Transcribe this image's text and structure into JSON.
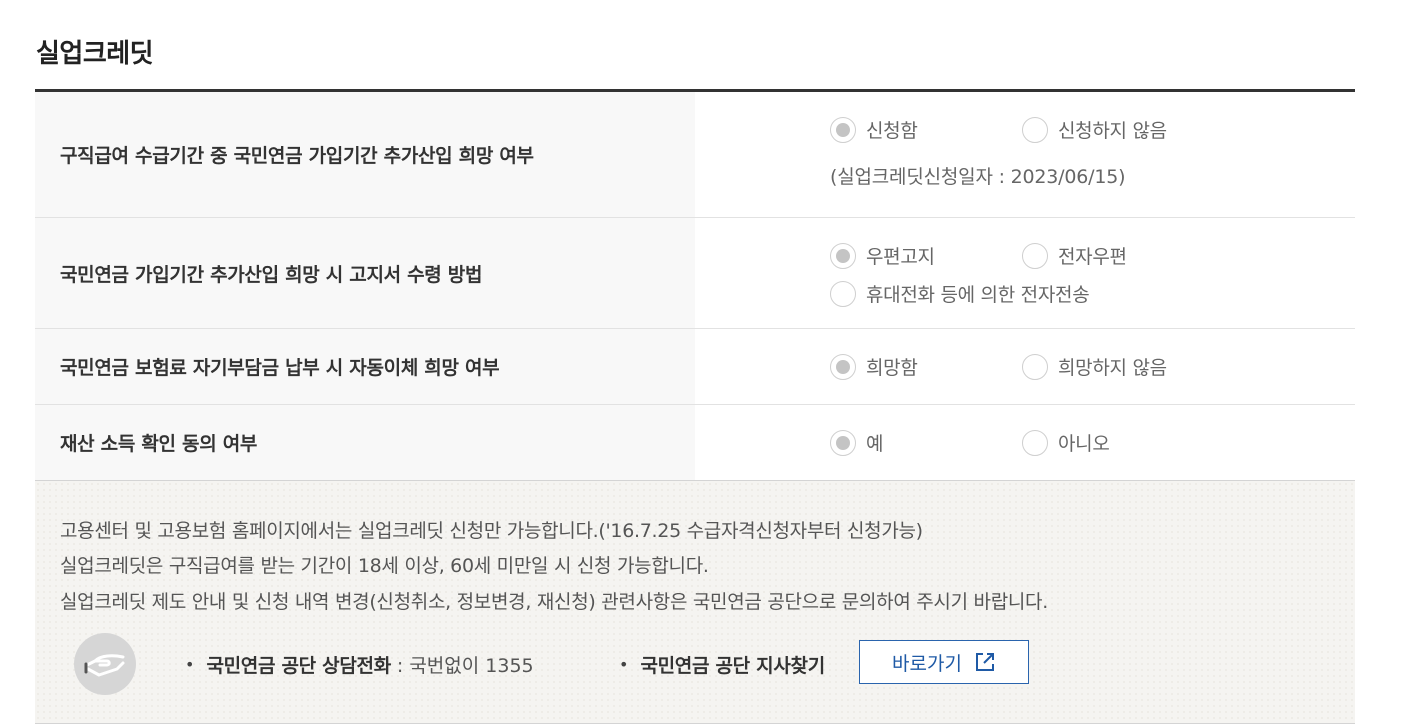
{
  "page_title": "실업크레딧",
  "rows": [
    {
      "label": "구직급여 수급기간 중 국민연금 가입기간 추가산입 희망 여부",
      "options": [
        "신청함",
        "신청하지 않음"
      ],
      "selected": 0,
      "note": "(실업크레딧신청일자 : 2023/06/15)"
    },
    {
      "label": "국민연금 가입기간 추가산입 희망 시 고지서 수령 방법",
      "options": [
        "우편고지",
        "전자우편",
        "휴대전화 등에 의한 전자전송"
      ],
      "selected": 0
    },
    {
      "label": "국민연금 보험료 자기부담금 납부 시 자동이체 희망 여부",
      "options": [
        "희망함",
        "희망하지 않음"
      ],
      "selected": 0
    },
    {
      "label": "재산 소득 확인 동의 여부",
      "options": [
        "예",
        "아니오"
      ],
      "selected": 0
    }
  ],
  "info": {
    "lines": [
      "고용센터 및 고용보험 홈페이지에서는 실업크레딧 신청만 가능합니다.('16.7.25 수급자격신청자부터 신청가능)",
      "실업크레딧은 구직급여를 받는 기간이 18세 이상, 60세 미만일 시 신청 가능합니다.",
      "실업크레딧 제도 안내 및 신청 내역 변경(신청취소, 정보변경, 재신청) 관련사항은 국민연금 공단으로 문의하여 주시기 바랍니다."
    ],
    "contact_label": "국민연금 공단 상담전화",
    "contact_value": ": 국번없이 1355",
    "branch_label": "국민연금 공단 지사찾기",
    "goto_label": "바로가기",
    "bullet": "•",
    "icon": "hand-icon"
  },
  "colors": {
    "accent_blue": "#1f5aa6",
    "radio_selected": "#c4c4c4",
    "label_bg": "#f8f8f8",
    "info_bg": "#f5f4f1"
  }
}
